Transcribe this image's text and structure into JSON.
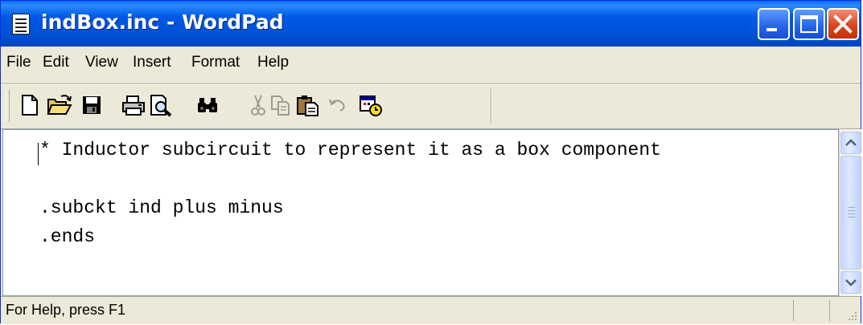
{
  "window": {
    "title": "indBox.inc - WordPad",
    "app_icon": "wordpad-document-icon",
    "controls": [
      "minimize-icon",
      "maximize-icon",
      "close-icon"
    ]
  },
  "menu": [
    {
      "label": "File"
    },
    {
      "label": "Edit"
    },
    {
      "label": "View"
    },
    {
      "label": "Insert"
    },
    {
      "label": "Format"
    },
    {
      "label": "Help"
    }
  ],
  "toolbar": [
    {
      "name": "new-icon",
      "enabled": true
    },
    {
      "name": "open-icon",
      "enabled": true
    },
    {
      "name": "save-icon",
      "enabled": true
    },
    {
      "name": "print-icon",
      "enabled": true
    },
    {
      "name": "print-preview-icon",
      "enabled": true
    },
    {
      "name": "find-icon",
      "enabled": true
    },
    {
      "name": "cut-icon",
      "enabled": false
    },
    {
      "name": "copy-icon",
      "enabled": false
    },
    {
      "name": "paste-icon",
      "enabled": true
    },
    {
      "name": "undo-icon",
      "enabled": false
    },
    {
      "name": "date-time-icon",
      "enabled": true
    }
  ],
  "document": {
    "lines": [
      "* Inductor subcircuit to represent it as a box component",
      "",
      ".subckt ind plus minus",
      ".ends"
    ]
  },
  "status": {
    "text": "For Help, press F1"
  },
  "colors": {
    "title_bar": "#0054e3",
    "close_button": "#d9451c",
    "chrome": "#ece9d8",
    "document_bg": "#ffffff"
  }
}
